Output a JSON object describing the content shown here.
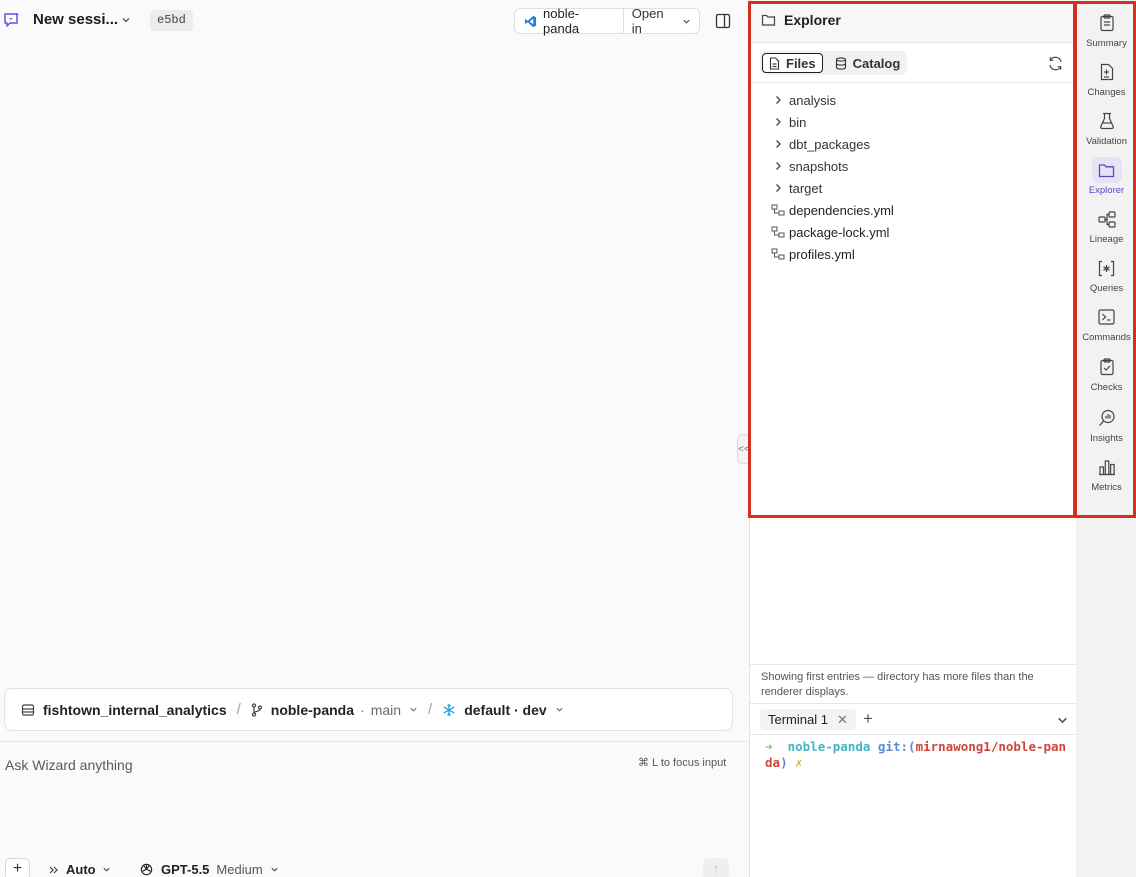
{
  "header": {
    "session_title": "New sessi...",
    "session_hash": "e5bd",
    "branch_button": "noble-panda",
    "open_in_label": "Open in"
  },
  "context_bar": {
    "project": "fishtown_internal_analytics",
    "branch": "noble-panda",
    "base_branch": "main",
    "environment": "default · dev"
  },
  "composer": {
    "placeholder": "Ask Wizard anything",
    "focus_hint": "⌘ L to focus input",
    "add_label": "+",
    "mode_label": "Auto",
    "model_label": "GPT-5.5",
    "effort_label": "Medium",
    "send_label": "↑"
  },
  "explorer": {
    "title": "Explorer",
    "tabs": [
      {
        "label": "Files",
        "active": true
      },
      {
        "label": "Catalog",
        "active": false
      }
    ],
    "folders": [
      "analysis",
      "bin",
      "dbt_packages",
      "snapshots",
      "target"
    ],
    "files": [
      "dependencies.yml",
      "package-lock.yml",
      "profiles.yml"
    ],
    "footer_note": "Showing first entries — directory has more files than the renderer displays."
  },
  "terminal": {
    "tab_label": "Terminal 1",
    "close_label": "✕",
    "add_label": "+",
    "prompt_arrow": "➜",
    "directory": "noble-panda",
    "git_prefix": "git:(",
    "git_branch": "mirnawong1/noble-panda",
    "git_suffix": ")",
    "dirty_marker": "✗"
  },
  "sidebar": {
    "items": [
      {
        "label": "Summary",
        "icon": "clipboard-icon",
        "active": false
      },
      {
        "label": "Changes",
        "icon": "file-diff-icon",
        "active": false
      },
      {
        "label": "Validation",
        "icon": "flask-icon",
        "active": false
      },
      {
        "label": "Explorer",
        "icon": "folder-icon",
        "active": true
      },
      {
        "label": "Lineage",
        "icon": "lineage-icon",
        "active": false
      },
      {
        "label": "Queries",
        "icon": "query-brackets-icon",
        "active": false
      },
      {
        "label": "Commands",
        "icon": "terminal-icon",
        "active": false
      },
      {
        "label": "Checks",
        "icon": "clipboard-check-icon",
        "active": false
      },
      {
        "label": "Insights",
        "icon": "search-chart-icon",
        "active": false
      },
      {
        "label": "Metrics",
        "icon": "bar-chart-icon",
        "active": false
      }
    ]
  },
  "colors": {
    "accent": "#5b46c9",
    "annotation_red": "#d5301f"
  }
}
